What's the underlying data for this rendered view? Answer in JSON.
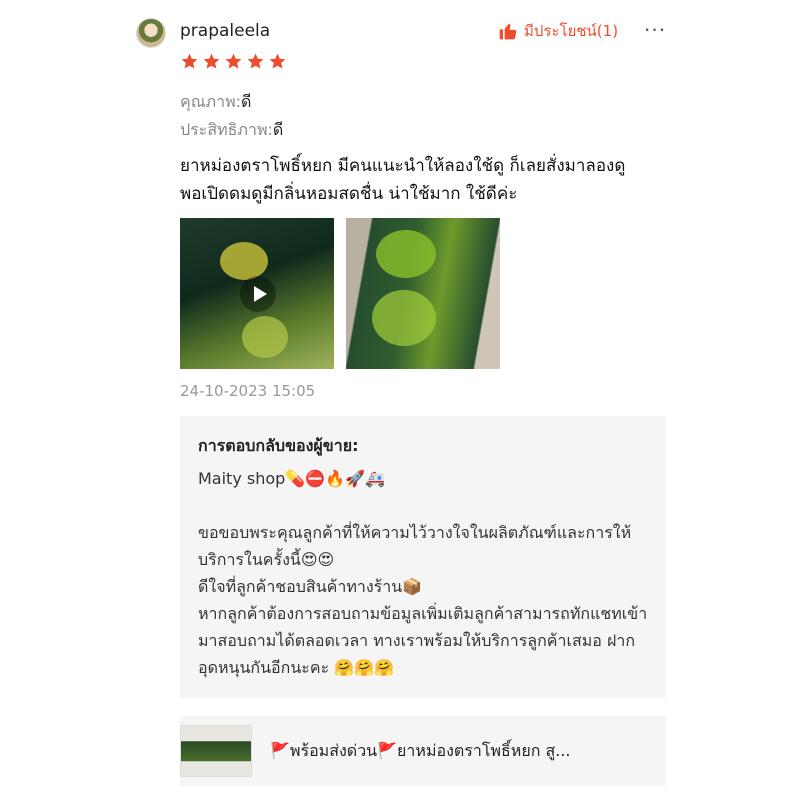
{
  "review": {
    "username": "prapaleela",
    "rating": 5,
    "helpful_label": "มีประโยชน์(1)",
    "attributes": [
      {
        "label": "คุณภาพ:",
        "value": "ดี"
      },
      {
        "label": "ประสิทธิภาพ:",
        "value": "ดี"
      }
    ],
    "text": "ยาหม่องตราโพธิ์หยก มีคนแนะนำให้ลองใช้ดู ก็เลยสั่งมาลองดู พอเปิดดมดูมีกลิ่นหอมสดชื่น น่าใช้มาก ใช้ดีค่ะ",
    "timestamp": "24-10-2023 15:05"
  },
  "seller_reply": {
    "title": "การตอบกลับของผู้ขาย:",
    "text": "Maity shop💊⛔🔥🚀🚑\n\nขอขอบพระคุณลูกค้าที่ให้ความไว้วางใจในผลิตภัณฑ์และการให้บริการในครั้งนี้😍😍\nดีใจที่ลูกค้าชอบสินค้าทางร้าน📦\nหากลูกค้าต้องการสอบถามข้อมูลเพิ่มเติมลูกค้าสามารถทักแชทเข้ามาสอบถามได้ตลอดเวลา ทางเราพร้อมให้บริการลูกค้าเสมอ ฝากอุดหนุนกันอีกนะคะ 🤗🤗🤗"
  },
  "product": {
    "title": "🚩พร้อมส่งด่วน🚩ยาหม่องตราโพธิ์หยก สู..."
  },
  "colors": {
    "accent": "#ee4d2d",
    "star": "#ee4d2d"
  }
}
